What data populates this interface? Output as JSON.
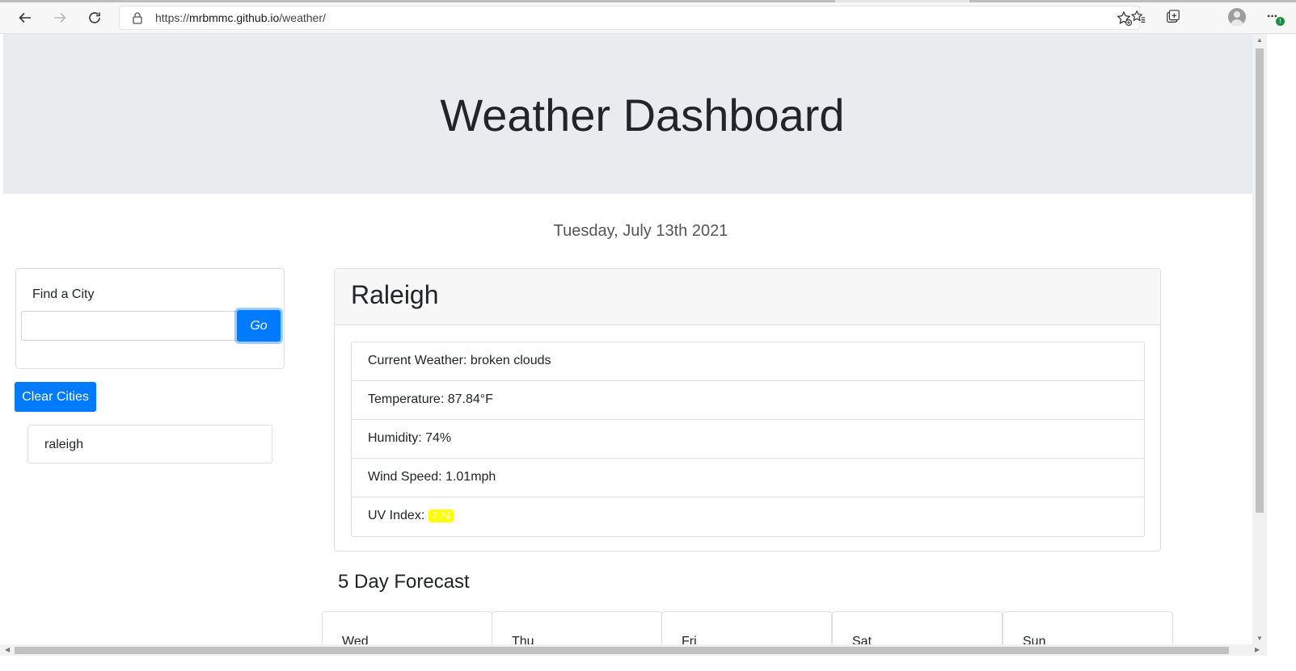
{
  "browser": {
    "url_prefix": "https://",
    "url_host": "mrbmmc.github.io",
    "url_path": "/weather/"
  },
  "page": {
    "title": "Weather Dashboard",
    "date": "Tuesday, July 13th 2021"
  },
  "search": {
    "label": "Find a City",
    "input_value": "",
    "go_label": "Go"
  },
  "clear_label": "Clear Cities",
  "history": [
    "raleigh"
  ],
  "current": {
    "city": "Raleigh",
    "weather": "Current Weather: broken clouds",
    "temperature": "Temperature: 87.84°F",
    "humidity": "Humidity: 74%",
    "wind": "Wind Speed: 1.01mph",
    "uv_label": "UV Index: ",
    "uv_value": "7.74",
    "uv_color": "#ffff00"
  },
  "forecast": {
    "title": "5 Day Forecast",
    "days": [
      "Wed",
      "Thu",
      "Fri",
      "Sat",
      "Sun"
    ]
  },
  "colors": {
    "primary": "#007bff",
    "jumbotron": "#e9ecef"
  },
  "icons": [
    "back-icon",
    "forward-icon",
    "refresh-icon",
    "lock-icon",
    "favorite-add-icon",
    "favorites-icon",
    "collections-icon",
    "profile-icon",
    "more-icon"
  ]
}
